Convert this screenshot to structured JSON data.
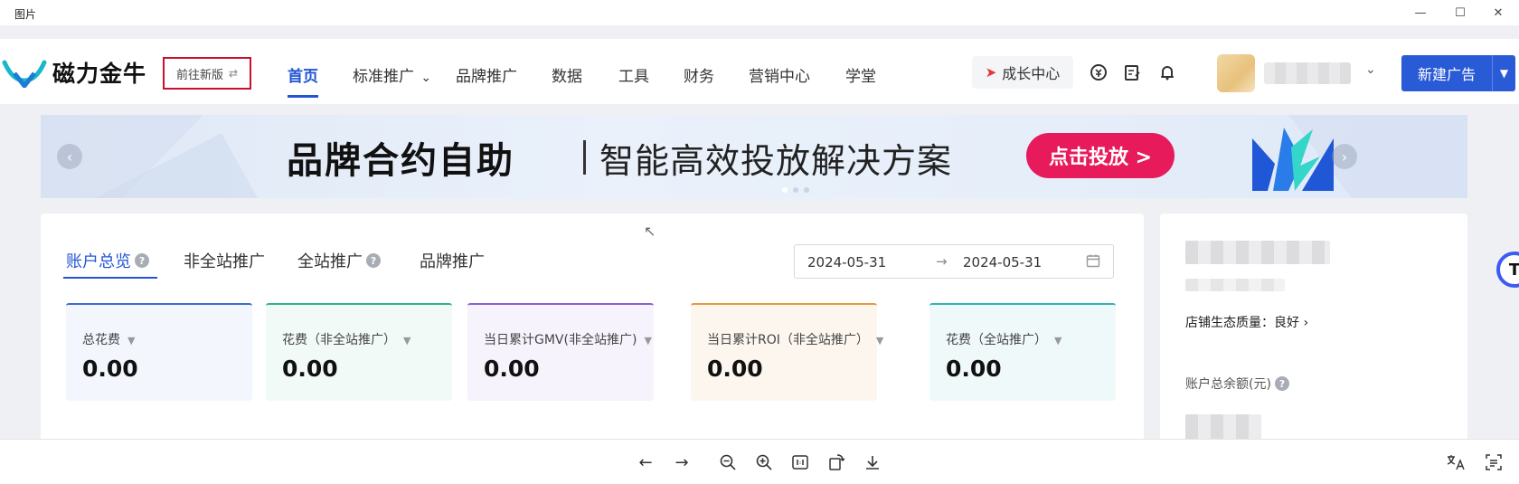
{
  "window": {
    "title": "图片",
    "minimize": "—",
    "maximize": "☐",
    "close": "✕"
  },
  "brand": {
    "name": "磁力金牛",
    "new_version_label": "前往新版",
    "swap_icon": "⇄",
    "accent": "#2255d6"
  },
  "nav": {
    "items": [
      {
        "label": "首页"
      },
      {
        "label": "标准推广"
      },
      {
        "label": "品牌推广"
      },
      {
        "label": "数据"
      },
      {
        "label": "工具"
      },
      {
        "label": "财务"
      },
      {
        "label": "营销中心"
      },
      {
        "label": "学堂"
      }
    ],
    "dropdown_caret": "⌄",
    "growth_center": "成长中心",
    "new_ad": "新建广告"
  },
  "banner": {
    "headline": "品牌合约自助",
    "subline": "智能高效投放解决方案",
    "cta": "点击投放 >",
    "prev": "‹",
    "next": "›",
    "cta_color": "#e71a5b"
  },
  "overview": {
    "tabs": [
      {
        "label": "账户总览",
        "help": "?"
      },
      {
        "label": "非全站推广"
      },
      {
        "label": "全站推广",
        "help": "?"
      },
      {
        "label": "品牌推广"
      }
    ],
    "date_start": "2024-05-31",
    "date_arrow": "→",
    "date_end": "2024-05-31",
    "metrics": [
      {
        "label": "总花费",
        "value": "0.00",
        "color": "#3d6ad6"
      },
      {
        "label": "花费（非全站推广）",
        "value": "0.00",
        "color": "#2fb58a"
      },
      {
        "label": "当日累计GMV(非全站推广)",
        "value": "0.00",
        "color": "#8a5fd6"
      },
      {
        "label": "当日累计ROI（非全站推广）",
        "value": "0.00",
        "color": "#e89a3c"
      },
      {
        "label": "花费（全站推广）",
        "value": "0.00",
        "color": "#2fb5b5"
      }
    ],
    "caret": "▼"
  },
  "side": {
    "eco_quality": "店铺生态质量：良好 ›",
    "balance_label": "账户总余额(元)",
    "help": "?"
  },
  "float_button": "T"
}
